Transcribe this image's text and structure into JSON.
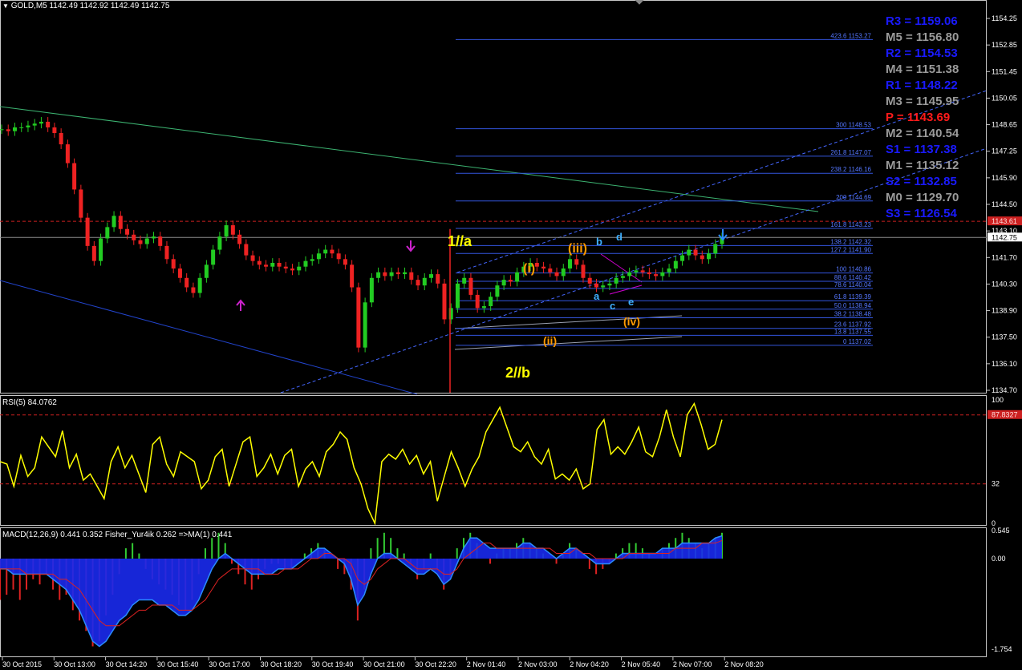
{
  "header": {
    "title": "GOLD,M5  1142.49 1142.92 1142.49 1142.75",
    "rsi_label": "RSI(5) 84.0762",
    "macd_label": "MACD(12,26,9) 0.441 0.352  Fisher_Yur4ik 0.262  =>MA(1) 0.441"
  },
  "pivots": [
    {
      "label": "R3 = 1159.06",
      "color": "#1a1aff"
    },
    {
      "label": "M5 = 1156.80",
      "color": "#9a9a9a"
    },
    {
      "label": "R2 = 1154.53",
      "color": "#1a1aff"
    },
    {
      "label": "M4 = 1151.38",
      "color": "#9a9a9a"
    },
    {
      "label": "R1 = 1148.22",
      "color": "#1a1aff"
    },
    {
      "label": "M3 = 1145.95",
      "color": "#9a9a9a"
    },
    {
      "label": "P  = 1143.69",
      "color": "#ff1a1a"
    },
    {
      "label": "M2 = 1140.54",
      "color": "#9a9a9a"
    },
    {
      "label": "S1 = 1137.38",
      "color": "#1a1aff"
    },
    {
      "label": "M1 = 1135.12",
      "color": "#9a9a9a"
    },
    {
      "label": "S2 = 1132.85",
      "color": "#1a1aff"
    },
    {
      "label": "M0 = 1129.70",
      "color": "#9a9a9a"
    },
    {
      "label": "S3 = 1126.54",
      "color": "#1a1aff"
    }
  ],
  "chart_data": {
    "type": "candlestick",
    "symbol": "GOLD",
    "timeframe": "M5",
    "ohlc": {
      "open": 1142.49,
      "high": 1142.92,
      "low": 1142.49,
      "close": 1142.75
    },
    "price_axis_ticks": [
      "1154.25",
      "1152.85",
      "1151.45",
      "1150.05",
      "1148.65",
      "1147.25",
      "1145.90",
      "1144.50",
      "1143.10",
      "1141.70",
      "1140.30",
      "1138.90",
      "1137.50",
      "1136.10",
      "1134.70"
    ],
    "current_price_tag": "1142.75",
    "pivot_price_tag": "1143.61",
    "ylim": [
      1134.5,
      1155.2
    ],
    "time_labels": [
      "30 Oct 2015",
      "30 Oct 13:00",
      "30 Oct 14:20",
      "30 Oct 15:40",
      "30 Oct 17:00",
      "30 Oct 18:20",
      "30 Oct 19:40",
      "30 Oct 21:00",
      "30 Oct 22:20",
      "2 Nov 01:40",
      "2 Nov 03:00",
      "2 Nov 04:20",
      "2 Nov 05:40",
      "2 Nov 07:00",
      "2 Nov 08:20"
    ],
    "close_path": [
      1148.5,
      1148.4,
      1148.6,
      1148.6,
      1148.7,
      1148.8,
      1148.9,
      1148.6,
      1148.3,
      1147.7,
      1146.7,
      1145.3,
      1143.8,
      1142.3,
      1141.5,
      1142.7,
      1143.3,
      1143.9,
      1143.2,
      1142.9,
      1142.6,
      1142.4,
      1142.7,
      1142.8,
      1142.3,
      1141.6,
      1141.1,
      1140.6,
      1140.1,
      1139.8,
      1140.6,
      1141.3,
      1142.1,
      1142.8,
      1143.4,
      1142.9,
      1142.4,
      1141.8,
      1141.5,
      1141.3,
      1141.2,
      1141.4,
      1141.2,
      1141.1,
      1141.0,
      1141.2,
      1141.5,
      1141.6,
      1141.9,
      1142.1,
      1141.9,
      1141.6,
      1141.3,
      1140.1,
      1136.9,
      1139.3,
      1140.6,
      1140.9,
      1140.7,
      1140.9,
      1140.8,
      1140.9,
      1140.5,
      1140.2,
      1140.6,
      1140.8,
      1140.3,
      1138.4,
      1139.0,
      1140.3,
      1140.6,
      1139.7,
      1139.0,
      1139.1,
      1139.6,
      1140.2,
      1140.5,
      1140.4,
      1140.9,
      1141.2,
      1141.4,
      1141.2,
      1141.1,
      1140.9,
      1140.7,
      1141.1,
      1141.6,
      1141.3,
      1140.6,
      1140.3,
      1140.1,
      1140.2,
      1140.3,
      1140.6,
      1140.7,
      1140.9,
      1141.0,
      1140.9,
      1140.8,
      1140.7,
      1140.9,
      1141.1,
      1141.5,
      1141.8,
      1142.1,
      1141.8,
      1141.6,
      1141.9,
      1142.4,
      1142.75
    ],
    "fibonacci_levels": [
      {
        "label": "423.6 1153.27",
        "price": 1153.27
      },
      {
        "label": "300 1148.53",
        "price": 1148.53
      },
      {
        "label": "261.8 1147.07",
        "price": 1147.07
      },
      {
        "label": "238.2 1146.16",
        "price": 1146.16
      },
      {
        "label": "200 1144.69",
        "price": 1144.69
      },
      {
        "label": "161.8 1143.23",
        "price": 1143.23
      },
      {
        "label": "138.2 1142.32",
        "price": 1142.32
      },
      {
        "label": "127.2 1141.90",
        "price": 1141.9
      },
      {
        "label": "100 1140.86",
        "price": 1140.86
      },
      {
        "label": "88.6 1140.42",
        "price": 1140.42
      },
      {
        "label": "78.6 1140.04",
        "price": 1140.04
      },
      {
        "label": "61.8 1139.39",
        "price": 1139.39
      },
      {
        "label": "50.0 1138.94",
        "price": 1138.94
      },
      {
        "label": "38.2 1138.48",
        "price": 1138.48
      },
      {
        "label": "23.6 1137.92",
        "price": 1137.92
      },
      {
        "label": "13.8 1137.55",
        "price": 1137.55
      },
      {
        "label": "0 1137.02",
        "price": 1137.02
      }
    ],
    "wave_labels": [
      {
        "text": "1//a",
        "color": "#ffff00"
      },
      {
        "text": "2//b",
        "color": "#ffff00"
      },
      {
        "text": "(i)",
        "color": "#ff9900"
      },
      {
        "text": "(ii)",
        "color": "#ff9900"
      },
      {
        "text": "(iii)",
        "color": "#ff9900"
      },
      {
        "text": "(iv)",
        "color": "#ff9900"
      },
      {
        "text": "a",
        "color": "#40b0ff"
      },
      {
        "text": "b",
        "color": "#40b0ff"
      },
      {
        "text": "c",
        "color": "#40b0ff"
      },
      {
        "text": "d",
        "color": "#40b0ff"
      },
      {
        "text": "e",
        "color": "#40b0ff"
      }
    ],
    "rsi": {
      "ticks": [
        "100",
        "32",
        "0"
      ],
      "overbought_tag": "87.8327",
      "levels": [
        87.83,
        32
      ],
      "values": [
        50,
        48,
        30,
        55,
        38,
        45,
        70,
        62,
        54,
        75,
        45,
        56,
        35,
        40,
        30,
        20,
        50,
        62,
        45,
        55,
        40,
        25,
        64,
        70,
        48,
        38,
        58,
        54,
        50,
        28,
        35,
        54,
        60,
        30,
        48,
        66,
        70,
        38,
        45,
        56,
        40,
        55,
        60,
        30,
        44,
        50,
        38,
        58,
        64,
        74,
        68,
        45,
        32,
        12,
        0,
        50,
        56,
        52,
        60,
        48,
        55,
        40,
        50,
        18,
        38,
        58,
        45,
        30,
        44,
        54,
        74,
        84,
        94,
        78,
        62,
        58,
        66,
        54,
        48,
        60,
        36,
        40,
        35,
        44,
        28,
        32,
        76,
        84,
        56,
        62,
        56,
        66,
        78,
        58,
        54,
        70,
        92,
        70,
        54,
        88,
        97,
        80,
        60,
        64,
        84
      ]
    },
    "macd": {
      "ticks": [
        "0.545",
        "0.00",
        "-1.754"
      ],
      "histogram": [
        -0.8,
        -0.7,
        -0.6,
        -0.8,
        -0.6,
        -0.4,
        -0.5,
        -0.3,
        -0.6,
        -0.8,
        -0.7,
        -1.0,
        -1.2,
        -1.4,
        -1.7,
        -1.6,
        -1.1,
        -0.7,
        -0.3,
        0.2,
        0.3,
        0.1,
        -0.2,
        -0.4,
        -0.5,
        -0.6,
        -0.7,
        -0.9,
        -1.0,
        -0.8,
        -0.3,
        0.2,
        0.4,
        0.5,
        0.3,
        -0.1,
        -0.3,
        -0.5,
        -0.6,
        -0.4,
        -0.2,
        -0.1,
        -0.1,
        -0.2,
        -0.2,
        0.0,
        0.1,
        0.2,
        0.3,
        0.2,
        0.0,
        -0.2,
        -0.3,
        -0.6,
        -1.2,
        -0.6,
        0.2,
        0.4,
        0.5,
        0.4,
        0.2,
        0.1,
        -0.1,
        -0.4,
        -0.2,
        0.1,
        -0.2,
        -0.6,
        -0.4,
        0.2,
        0.4,
        0.5,
        0.3,
        0.0,
        -0.1,
        0.1,
        0.2,
        0.2,
        0.3,
        0.4,
        0.3,
        0.2,
        0.1,
        0.0,
        -0.1,
        0.1,
        0.3,
        0.2,
        0.0,
        -0.2,
        -0.3,
        -0.2,
        -0.1,
        0.1,
        0.2,
        0.3,
        0.3,
        0.2,
        0.1,
        0.0,
        0.2,
        0.3,
        0.4,
        0.5,
        0.4,
        0.3,
        0.2,
        0.3,
        0.4,
        0.5
      ],
      "main": [
        -0.2,
        -0.2,
        -0.3,
        -0.3,
        -0.3,
        -0.3,
        -0.3,
        -0.3,
        -0.4,
        -0.5,
        -0.6,
        -0.8,
        -1.0,
        -1.3,
        -1.6,
        -1.7,
        -1.6,
        -1.4,
        -1.2,
        -1.1,
        -0.9,
        -0.8,
        -0.8,
        -0.8,
        -0.9,
        -0.9,
        -1.0,
        -1.1,
        -1.1,
        -1.0,
        -0.8,
        -0.5,
        -0.2,
        0.0,
        0.1,
        0.0,
        -0.1,
        -0.2,
        -0.3,
        -0.3,
        -0.3,
        -0.3,
        -0.2,
        -0.2,
        -0.2,
        -0.1,
        0.0,
        0.1,
        0.2,
        0.2,
        0.1,
        0.0,
        -0.1,
        -0.4,
        -0.9,
        -0.7,
        -0.3,
        0.0,
        0.1,
        0.1,
        0.0,
        -0.1,
        -0.2,
        -0.3,
        -0.3,
        -0.2,
        -0.3,
        -0.5,
        -0.4,
        -0.1,
        0.2,
        0.4,
        0.4,
        0.3,
        0.2,
        0.2,
        0.2,
        0.2,
        0.2,
        0.3,
        0.3,
        0.2,
        0.2,
        0.1,
        0.0,
        0.1,
        0.2,
        0.2,
        0.1,
        0.0,
        -0.1,
        -0.1,
        -0.1,
        0.0,
        0.1,
        0.1,
        0.1,
        0.1,
        0.1,
        0.1,
        0.2,
        0.2,
        0.2,
        0.3,
        0.3,
        0.3,
        0.3,
        0.3,
        0.4,
        0.44
      ],
      "signal": [
        -0.2,
        -0.2,
        -0.2,
        -0.2,
        -0.3,
        -0.3,
        -0.3,
        -0.3,
        -0.3,
        -0.4,
        -0.4,
        -0.5,
        -0.6,
        -0.8,
        -1.0,
        -1.2,
        -1.3,
        -1.3,
        -1.3,
        -1.2,
        -1.1,
        -1.0,
        -1.0,
        -0.9,
        -0.9,
        -0.9,
        -0.9,
        -1.0,
        -1.0,
        -1.0,
        -0.9,
        -0.8,
        -0.6,
        -0.4,
        -0.3,
        -0.2,
        -0.2,
        -0.2,
        -0.2,
        -0.2,
        -0.3,
        -0.3,
        -0.3,
        -0.2,
        -0.2,
        -0.2,
        -0.1,
        0.0,
        0.0,
        0.1,
        0.1,
        0.0,
        0.0,
        -0.1,
        -0.4,
        -0.5,
        -0.4,
        -0.2,
        -0.1,
        0.0,
        0.0,
        0.0,
        -0.1,
        -0.2,
        -0.2,
        -0.2,
        -0.2,
        -0.3,
        -0.3,
        -0.2,
        0.0,
        0.1,
        0.2,
        0.3,
        0.3,
        0.2,
        0.2,
        0.2,
        0.2,
        0.2,
        0.2,
        0.2,
        0.2,
        0.2,
        0.1,
        0.1,
        0.1,
        0.2,
        0.1,
        0.1,
        0.0,
        0.0,
        0.0,
        0.0,
        0.0,
        0.1,
        0.1,
        0.1,
        0.1,
        0.1,
        0.1,
        0.1,
        0.2,
        0.2,
        0.2,
        0.2,
        0.3,
        0.3,
        0.3,
        0.35
      ]
    }
  }
}
